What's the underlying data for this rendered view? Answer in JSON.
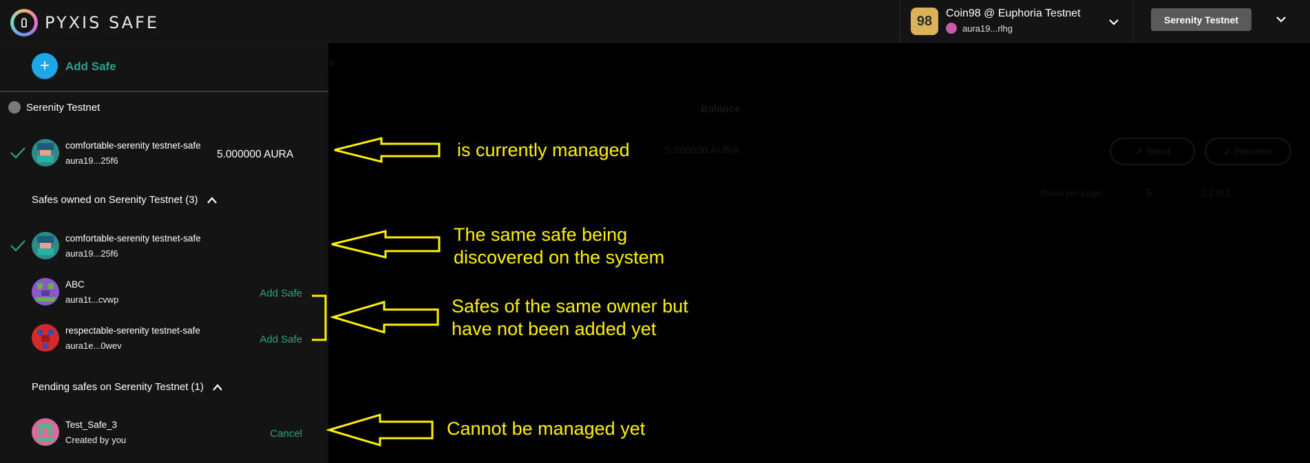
{
  "header": {
    "logo_text": "PYXIS SAFE",
    "wallet": {
      "name": "Coin98 @ Euphoria Testnet",
      "address": "aura19...rlhg"
    },
    "network_button": "Serenity Testnet"
  },
  "background": {
    "balance_label": "Balance",
    "balance_value": "5.000000 AURA",
    "send_label": "↗ Send",
    "receive_label": "↙ Receive",
    "rows_per_page_label": "Rows per page:",
    "rows_per_page_value": "5",
    "pagination": "1-1 of 1",
    "partial_text": "es"
  },
  "sidebar": {
    "add_safe_label": "Add Safe",
    "network_label": "Serenity Testnet",
    "current_safe": {
      "name": "comfortable-serenity testnet-safe",
      "address": "aura19...25f6",
      "balance": "5.000000 AURA"
    },
    "owned_section": {
      "title": "Safes owned on Serenity Testnet (3)",
      "items": [
        {
          "name": "comfortable-serenity testnet-safe",
          "address": "aura19...25f6",
          "action": ""
        },
        {
          "name": "ABC",
          "address": "aura1t...cvwp",
          "action": "Add Safe"
        },
        {
          "name": "respectable-serenity testnet-safe",
          "address": "aura1e...0wev",
          "action": "Add Safe"
        }
      ]
    },
    "pending_section": {
      "title": "Pending safes on Serenity Testnet (1)",
      "items": [
        {
          "name": "Test_Safe_3",
          "address": "Created by you",
          "action": "Cancel"
        }
      ]
    }
  },
  "annotations": {
    "managed": "is currently managed",
    "discovered_1": "The same safe being",
    "discovered_2": "discovered on the system",
    "not_added_1": "Safes of the same owner but",
    "not_added_2": "have not been added yet",
    "pending": "Cannot be managed yet"
  },
  "colors": {
    "accent_green": "#2aa58a",
    "add_button_blue": "#1ea7e8",
    "annotation_yellow": "#fff200"
  }
}
